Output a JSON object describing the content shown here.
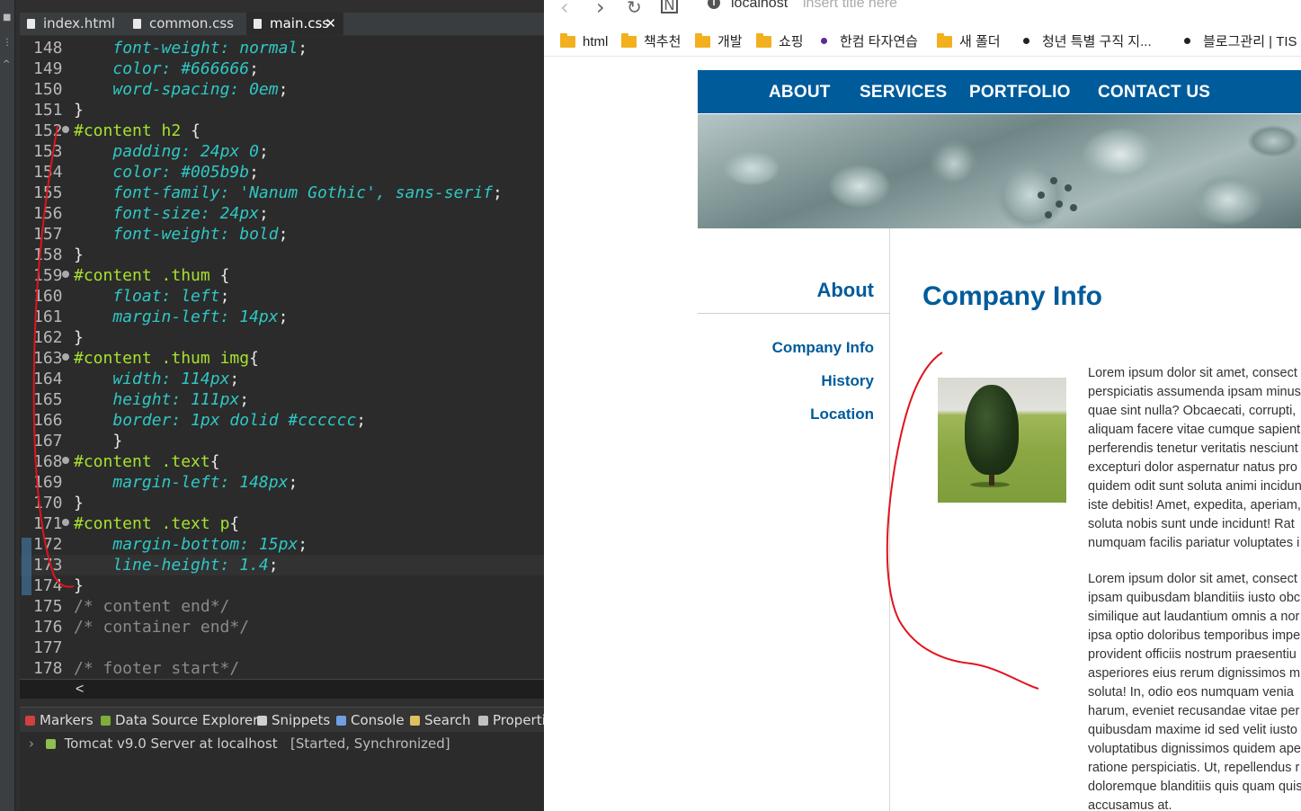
{
  "ide": {
    "tabs": [
      {
        "label": "index.html"
      },
      {
        "label": "common.css"
      },
      {
        "label": "main.css",
        "close": "✕"
      }
    ],
    "lines": [
      {
        "n": "148",
        "t": [
          [
            "sp",
            "    "
          ],
          [
            "prop",
            "font-weight: "
          ],
          [
            "val",
            "normal"
          ],
          [
            "punc",
            ";"
          ]
        ]
      },
      {
        "n": "149",
        "t": [
          [
            "sp",
            "    "
          ],
          [
            "prop",
            "color: "
          ],
          [
            "val",
            "#666666"
          ],
          [
            "punc",
            ";"
          ]
        ]
      },
      {
        "n": "150",
        "t": [
          [
            "sp",
            "    "
          ],
          [
            "prop",
            "word-spacing: "
          ],
          [
            "val",
            "0em"
          ],
          [
            "punc",
            ";"
          ]
        ]
      },
      {
        "n": "151",
        "t": [
          [
            "punc",
            "}"
          ]
        ]
      },
      {
        "n": "152",
        "fold": true,
        "t": [
          [
            "sel-id",
            "#content "
          ],
          [
            "sel-tag",
            "h2 "
          ],
          [
            "punc",
            "{"
          ]
        ]
      },
      {
        "n": "153",
        "t": [
          [
            "sp",
            "    "
          ],
          [
            "prop",
            "padding: "
          ],
          [
            "val",
            "24px 0"
          ],
          [
            "punc",
            ";"
          ]
        ]
      },
      {
        "n": "154",
        "t": [
          [
            "sp",
            "    "
          ],
          [
            "prop",
            "color: "
          ],
          [
            "val",
            "#005b9b"
          ],
          [
            "punc",
            ";"
          ]
        ]
      },
      {
        "n": "155",
        "t": [
          [
            "sp",
            "    "
          ],
          [
            "prop",
            "font-family: "
          ],
          [
            "val",
            "'Nanum Gothic', sans-serif"
          ],
          [
            "punc",
            ";"
          ]
        ]
      },
      {
        "n": "156",
        "t": [
          [
            "sp",
            "    "
          ],
          [
            "prop",
            "font-size: "
          ],
          [
            "val",
            "24px"
          ],
          [
            "punc",
            ";"
          ]
        ]
      },
      {
        "n": "157",
        "t": [
          [
            "sp",
            "    "
          ],
          [
            "prop",
            "font-weight: "
          ],
          [
            "val",
            "bold"
          ],
          [
            "punc",
            ";"
          ]
        ]
      },
      {
        "n": "158",
        "t": [
          [
            "punc",
            "}"
          ]
        ]
      },
      {
        "n": "159",
        "fold": true,
        "t": [
          [
            "sel-id",
            "#content "
          ],
          [
            "sel-tag",
            ".thum "
          ],
          [
            "punc",
            "{"
          ]
        ]
      },
      {
        "n": "160",
        "t": [
          [
            "sp",
            "    "
          ],
          [
            "prop",
            "float: "
          ],
          [
            "val",
            "left"
          ],
          [
            "punc",
            ";"
          ]
        ]
      },
      {
        "n": "161",
        "t": [
          [
            "sp",
            "    "
          ],
          [
            "prop",
            "margin-left: "
          ],
          [
            "val",
            "14px"
          ],
          [
            "punc",
            ";"
          ]
        ]
      },
      {
        "n": "162",
        "t": [
          [
            "punc",
            "}"
          ]
        ]
      },
      {
        "n": "163",
        "fold": true,
        "t": [
          [
            "sel-id",
            "#content "
          ],
          [
            "sel-tag",
            ".thum img"
          ],
          [
            "punc",
            "{"
          ]
        ]
      },
      {
        "n": "164",
        "t": [
          [
            "sp",
            "    "
          ],
          [
            "prop",
            "width: "
          ],
          [
            "val",
            "114px"
          ],
          [
            "punc",
            ";"
          ]
        ]
      },
      {
        "n": "165",
        "t": [
          [
            "sp",
            "    "
          ],
          [
            "prop",
            "height: "
          ],
          [
            "val",
            "111px"
          ],
          [
            "punc",
            ";"
          ]
        ]
      },
      {
        "n": "166",
        "t": [
          [
            "sp",
            "    "
          ],
          [
            "prop",
            "border: "
          ],
          [
            "val",
            "1px dolid #cccccc"
          ],
          [
            "punc",
            ";"
          ]
        ]
      },
      {
        "n": "167",
        "t": [
          [
            "sp",
            "    "
          ],
          [
            "punc",
            "}"
          ]
        ]
      },
      {
        "n": "168",
        "fold": true,
        "t": [
          [
            "sel-id",
            "#content "
          ],
          [
            "sel-tag",
            ".text"
          ],
          [
            "punc",
            "{"
          ]
        ]
      },
      {
        "n": "169",
        "t": [
          [
            "sp",
            "    "
          ],
          [
            "prop",
            "margin-left: "
          ],
          [
            "val",
            "148px"
          ],
          [
            "punc",
            ";"
          ]
        ]
      },
      {
        "n": "170",
        "t": [
          [
            "punc",
            "}"
          ]
        ]
      },
      {
        "n": "171",
        "fold": true,
        "t": [
          [
            "sel-id",
            "#content "
          ],
          [
            "sel-tag",
            ".text p"
          ],
          [
            "punc",
            "{"
          ]
        ]
      },
      {
        "n": "172",
        "t": [
          [
            "sp",
            "    "
          ],
          [
            "prop",
            "margin-bottom: "
          ],
          [
            "val",
            "15px"
          ],
          [
            "punc",
            ";"
          ]
        ]
      },
      {
        "n": "173",
        "current": true,
        "t": [
          [
            "sp",
            "    "
          ],
          [
            "prop",
            "line-height: "
          ],
          [
            "val",
            "1.4"
          ],
          [
            "punc",
            ";"
          ]
        ]
      },
      {
        "n": "174",
        "t": [
          [
            "punc",
            "}"
          ]
        ]
      },
      {
        "n": "175",
        "t": [
          [
            "comment",
            "/* content end*/"
          ]
        ]
      },
      {
        "n": "176",
        "t": [
          [
            "comment",
            "/* container end*/"
          ]
        ]
      },
      {
        "n": "177",
        "t": []
      },
      {
        "n": "178",
        "t": [
          [
            "comment",
            "/* footer start*/"
          ]
        ]
      }
    ],
    "scroll_arrow": "<",
    "panel_tabs": [
      {
        "label": "Markers",
        "color": "#d04040"
      },
      {
        "label": "Data Source Explorer",
        "color": "#7cae3a"
      },
      {
        "label": "Snippets",
        "color": "#d0d0d0"
      },
      {
        "label": "Console",
        "color": "#6fa0e0"
      },
      {
        "label": "Search",
        "color": "#e0c060"
      },
      {
        "label": "Properti",
        "color": "#c0c0c0"
      }
    ],
    "server": {
      "name": "Tomcat v9.0 Server at localhost",
      "status": "[Started, Synchronized]"
    }
  },
  "browser": {
    "url_host": "localhost",
    "url_title": "insert title here",
    "bookmarks": [
      {
        "type": "folder",
        "label": "html"
      },
      {
        "type": "folder",
        "label": "책추천"
      },
      {
        "type": "folder",
        "label": "개발"
      },
      {
        "type": "folder",
        "label": "쇼핑"
      },
      {
        "type": "dot-purple",
        "label": "한컴 타자연습"
      },
      {
        "type": "folder",
        "label": "새 폴더"
      },
      {
        "type": "dot",
        "label": "청년 특별 구직 지..."
      },
      {
        "type": "dot",
        "label": "블로그관리 | TIS"
      }
    ]
  },
  "site": {
    "nav": [
      "ABOUT",
      "SERVICES",
      "PORTFOLIO",
      "CONTACT US"
    ],
    "sidebar_title": "About",
    "sidebar_links": [
      "Company Info",
      "History",
      "Location"
    ],
    "page_title": "Company Info",
    "para1": [
      "Lorem ipsum dolor sit amet, consect",
      "perspiciatis assumenda ipsam minus",
      "quae sint nulla? Obcaecati, corrupti,",
      "aliquam facere vitae cumque sapient",
      "perferendis tenetur veritatis nesciunt",
      "excepturi dolor aspernatur natus pro",
      "quidem odit sunt soluta animi incidun",
      "iste debitis! Amet, expedita, aperiam,",
      "soluta nobis sunt unde incidunt! Rat",
      "numquam facilis pariatur voluptates i"
    ],
    "para2": [
      "Lorem ipsum dolor sit amet, consect",
      "ipsam quibusdam blanditiis iusto obc",
      "similique aut laudantium omnis a nor",
      "ipsa optio doloribus temporibus impe",
      "provident officiis nostrum praesentiu",
      "asperiores eius rerum dignissimos mi",
      "soluta! In, odio eos numquam venia",
      "harum, eveniet recusandae vitae per",
      "quibusdam maxime id sed velit iusto",
      "voluptatibus dignissimos quidem ape",
      "ratione perspiciatis. Ut, repellendus r",
      "doloremque blanditiis quis quam quis",
      "accusamus at."
    ]
  },
  "colors": {
    "brand": "#005b9b",
    "annotation": "#e0141e",
    "code_prop": "#2fc7c4",
    "code_selector": "#a7e22e"
  }
}
